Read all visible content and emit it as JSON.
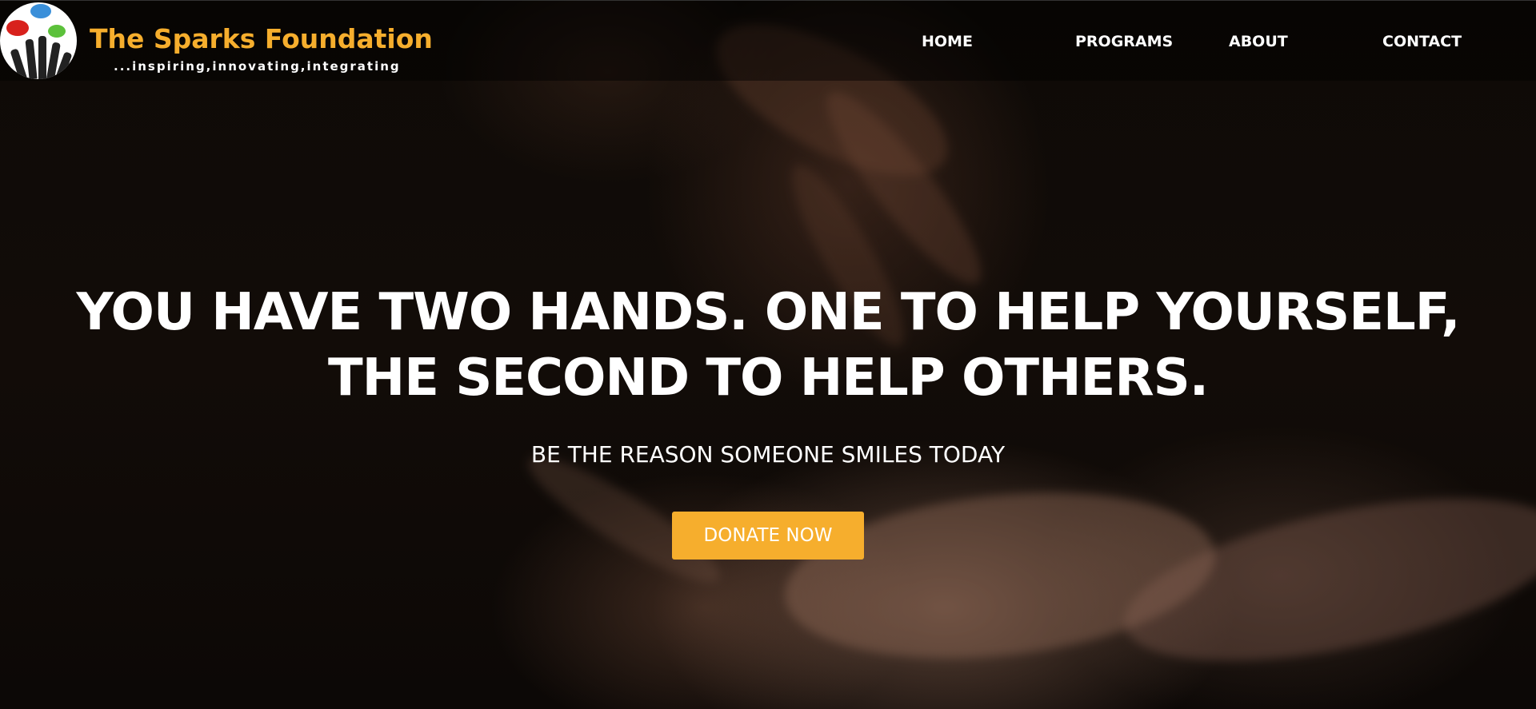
{
  "brand": {
    "name": "The Sparks Foundation",
    "tagline": "...inspiring,innovating,integrating",
    "accent_color": "#f6ae2d",
    "logo_icon": "raised-hands-speech-bubbles-logo"
  },
  "nav": {
    "items": [
      {
        "label": "HOME"
      },
      {
        "label": "PROGRAMS"
      },
      {
        "label": "ABOUT"
      },
      {
        "label": "CONTACT"
      }
    ]
  },
  "hero": {
    "headline_line1": "YOU HAVE TWO HANDS. ONE TO HELP YOURSELF,",
    "headline_line2": "THE SECOND TO HELP OTHERS.",
    "subheadline": "BE THE REASON SOMEONE SMILES TODAY",
    "cta_label": "DONATE NOW",
    "cta_color": "#f6ae2d"
  }
}
